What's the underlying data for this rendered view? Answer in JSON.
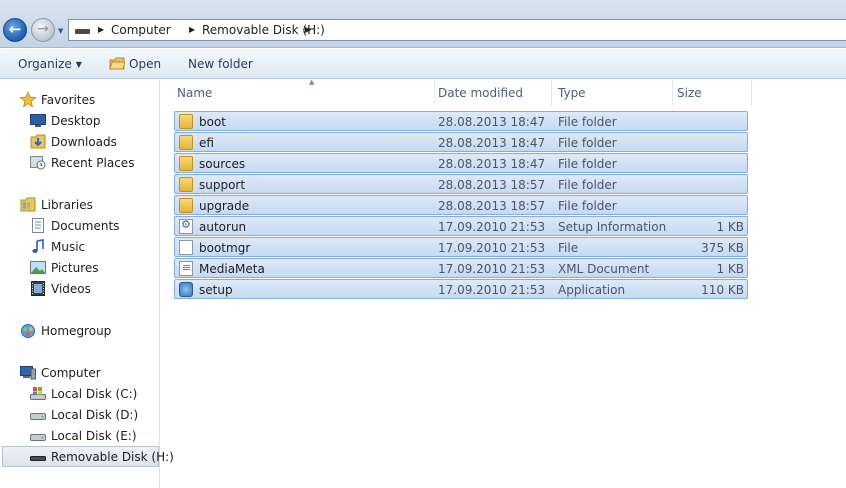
{
  "address": {
    "crumbs": [
      "Computer",
      "Removable Disk (H:)"
    ]
  },
  "toolbar": {
    "organize_label": "Organize",
    "open_label": "Open",
    "new_folder_label": "New folder"
  },
  "sidebar": {
    "items": [
      {
        "label": "Favorites",
        "icon": "star-icon"
      },
      {
        "label": "Desktop",
        "icon": "desktop-icon"
      },
      {
        "label": "Downloads",
        "icon": "downloads-icon"
      },
      {
        "label": "Recent Places",
        "icon": "recent-places-icon"
      },
      {
        "label": "Libraries",
        "icon": "libraries-icon"
      },
      {
        "label": "Documents",
        "icon": "documents-icon"
      },
      {
        "label": "Music",
        "icon": "music-icon"
      },
      {
        "label": "Pictures",
        "icon": "pictures-icon"
      },
      {
        "label": "Videos",
        "icon": "videos-icon"
      },
      {
        "label": "Homegroup",
        "icon": "homegroup-icon"
      },
      {
        "label": "Computer",
        "icon": "computer-icon"
      },
      {
        "label": "Local Disk (C:)",
        "icon": "drive-c-icon"
      },
      {
        "label": "Local Disk (D:)",
        "icon": "drive-icon"
      },
      {
        "label": "Local Disk (E:)",
        "icon": "drive-icon"
      },
      {
        "label": "Removable Disk (H:)",
        "icon": "removable-drive-icon"
      }
    ]
  },
  "columns": {
    "name": "Name",
    "date": "Date modified",
    "type": "Type",
    "size": "Size"
  },
  "files": [
    {
      "name": "boot",
      "date": "28.08.2013 18:47",
      "type": "File folder",
      "size": "",
      "icon": "folder-icon"
    },
    {
      "name": "efi",
      "date": "28.08.2013 18:47",
      "type": "File folder",
      "size": "",
      "icon": "folder-icon"
    },
    {
      "name": "sources",
      "date": "28.08.2013 18:47",
      "type": "File folder",
      "size": "",
      "icon": "folder-icon"
    },
    {
      "name": "support",
      "date": "28.08.2013 18:57",
      "type": "File folder",
      "size": "",
      "icon": "folder-icon"
    },
    {
      "name": "upgrade",
      "date": "28.08.2013 18:57",
      "type": "File folder",
      "size": "",
      "icon": "folder-icon"
    },
    {
      "name": "autorun",
      "date": "17.09.2010 21:53",
      "type": "Setup Information",
      "size": "1 KB",
      "icon": "setup-info-icon"
    },
    {
      "name": "bootmgr",
      "date": "17.09.2010 21:53",
      "type": "File",
      "size": "375 KB",
      "icon": "file-icon"
    },
    {
      "name": "MediaMeta",
      "date": "17.09.2010 21:53",
      "type": "XML Document",
      "size": "1 KB",
      "icon": "xml-icon"
    },
    {
      "name": "setup",
      "date": "17.09.2010 21:53",
      "type": "Application",
      "size": "110 KB",
      "icon": "application-icon"
    }
  ]
}
